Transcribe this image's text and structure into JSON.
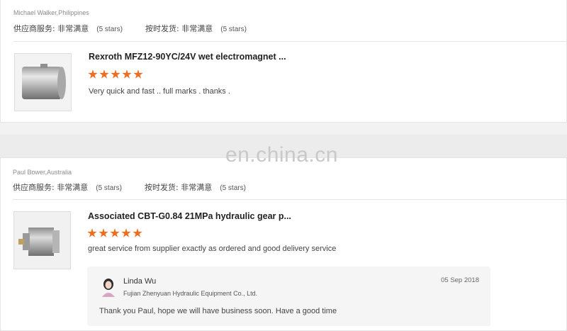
{
  "reviews": [
    {
      "reviewer": "Michael Walker,Philippines",
      "supplier_service_label": "供应商服务: 非常满意",
      "supplier_service_stars": "(5 stars)",
      "ontime_label": "按时发货: 非常满意",
      "ontime_stars": "(5 stars)",
      "product_title": "Rexroth MFZ12-90YC/24V wet electromagnet ...",
      "rating": 5,
      "comment": "Very quick and fast .. full marks . thanks ."
    },
    {
      "reviewer": "Paul Bower,Australia",
      "supplier_service_label": "供应商服务: 非常满意",
      "supplier_service_stars": "(5 stars)",
      "ontime_label": "按时发货: 非常满意",
      "ontime_stars": "(5 stars)",
      "product_title": "Associated CBT-G0.84 21MPa hydraulic gear p...",
      "rating": 5,
      "comment": "great service from supplier exactly as ordered and good delivery service",
      "reply": {
        "name": "Linda Wu",
        "company": "Fujian Zhenyuan Hydraulic Equipment Co., Ltd.",
        "date": "05 Sep 2018",
        "message": "Thank you Paul, hope we will have business soon. Have a good time"
      }
    }
  ],
  "watermark": "en.china.cn",
  "colors": {
    "star": "#f26c1f",
    "card_bg": "#ffffff",
    "page_bg": "#f2f2f2"
  }
}
